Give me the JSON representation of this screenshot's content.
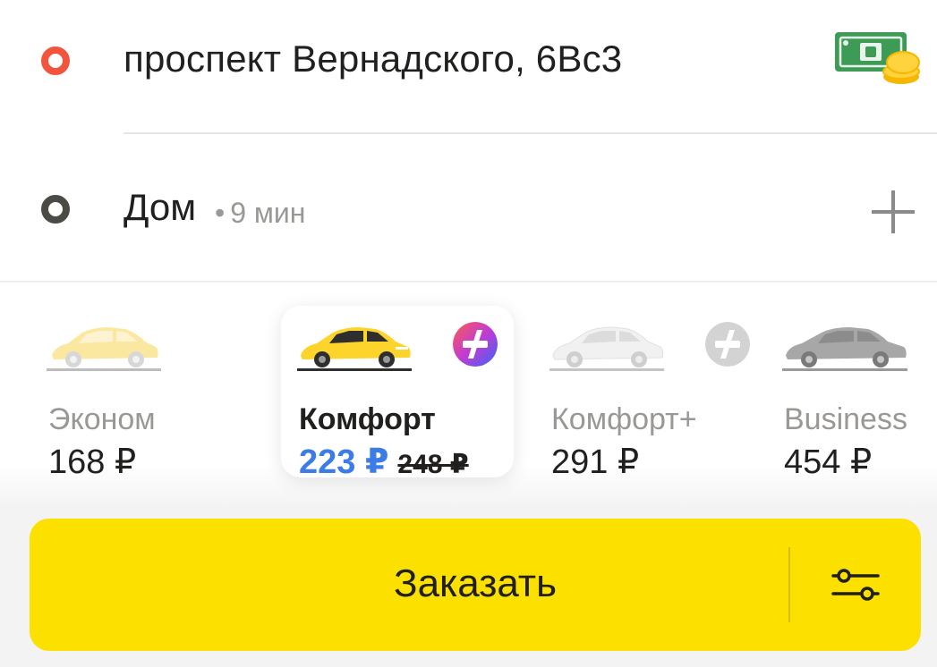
{
  "route": {
    "from": {
      "address": "проспект Вернадского, 6Вс3",
      "point_color": "#f2543d"
    },
    "to": {
      "label": "Дом",
      "separator": "•",
      "eta": "9 мин",
      "point_color": "#4c4a45"
    },
    "payment_icon": "cash-icon",
    "add_stop_icon": "plus-icon"
  },
  "tariffs": [
    {
      "name": "Эконом",
      "price": "168 ₽",
      "selected": false,
      "car_color": "#fbe8a0"
    },
    {
      "name": "Комфорт",
      "price": "223 ₽",
      "old_price": "248 ₽",
      "selected": true,
      "car_color": "#fcd42b",
      "badge": "plus-gradient-icon"
    },
    {
      "name": "Комфорт+",
      "price": "291 ₽",
      "selected": false,
      "car_color": "#f1f1f1",
      "badge": "plus-gray-icon"
    },
    {
      "name": "Business",
      "price": "454 ₽",
      "selected": false,
      "car_color": "#a7a7a7"
    }
  ],
  "order": {
    "label": "Заказать",
    "button_color": "#fce000",
    "options_icon": "sliders-icon"
  }
}
